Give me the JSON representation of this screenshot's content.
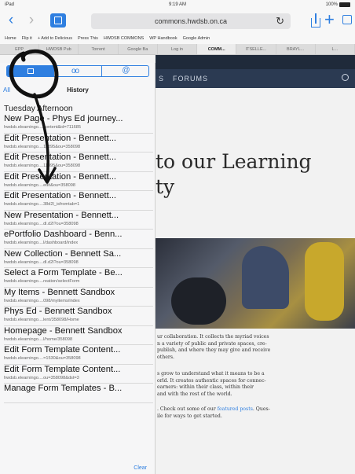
{
  "statusbar": {
    "carrier": "iPad",
    "time": "9:19 AM",
    "battery": "100%"
  },
  "browser": {
    "url": "commons.hwdsb.on.ca",
    "favorites": [
      "Home",
      "Flip it",
      "+ Add to Delicious",
      "Press This",
      "HWDSB COMMONS",
      "WP Handbook",
      "Google Admin"
    ],
    "tabs": [
      {
        "label": "EPP",
        "active": false
      },
      {
        "label": "HWDSB Pub",
        "active": false
      },
      {
        "label": "Torrent",
        "active": false
      },
      {
        "label": "Google Ba",
        "active": false
      },
      {
        "label": "Log in",
        "active": false
      },
      {
        "label": "COMM...",
        "active": true
      },
      {
        "label": "ITSELLE...",
        "active": false
      },
      {
        "label": "BRAYL...",
        "active": false
      },
      {
        "label": "L...",
        "active": false
      }
    ]
  },
  "bookmarks": {
    "back_label": "All",
    "title": "History",
    "section": "Tuesday Afternoon",
    "clear_label": "Clear",
    "items": [
      {
        "title": "New Page - Phys Ed journey...",
        "url": "hwdsb.elearningo....content&id=711685"
      },
      {
        "title": "Edit Presentation - Bennett...",
        "url": "hwdsb.elearningo....11895&ou=358098"
      },
      {
        "title": "Edit Presentation - Bennett...",
        "url": "hwdsb.elearningo....11895&ou=358098"
      },
      {
        "title": "Edit Presentation - Bennett...",
        "url": "hwdsb.elearningo....edit&ou=358098"
      },
      {
        "title": "Edit Presentation - Bennett...",
        "url": "hwdsb.elearningo....38d2l_isfromtab=1"
      },
      {
        "title": "New Presentation - Bennett...",
        "url": "hwdsb.elearningo....dl.d2l?ou=358098"
      },
      {
        "title": "ePortfolio Dashboard - Benn...",
        "url": "hwdsb.elearningo....l/dashboard/index"
      },
      {
        "title": "New Collection - Bennett Sa...",
        "url": "hwdsb.elearningo....dl.d2l?ou=358098"
      },
      {
        "title": "Select a Form Template - Be...",
        "url": "hwdsb.elearningo....reation/selectForm"
      },
      {
        "title": "My Items - Bennett Sandbox",
        "url": "hwdsb.elearningo....098/myitems/index"
      },
      {
        "title": "Phys Ed - Bennett Sandbox",
        "url": "hwdsb.elearningo....lent/358098/Home"
      },
      {
        "title": "Homepage - Bennett Sandbox",
        "url": "hwdsb.elearningo....l/home/358098"
      },
      {
        "title": "Edit Form Template Content...",
        "url": "hwdsb.elearningo....=1530&ou=358098"
      },
      {
        "title": "Edit Form Template Content...",
        "url": "hwdsb.elearningo....ou=358098&dst=3"
      },
      {
        "title": "Manage Form Templates - B...",
        "url": ""
      }
    ]
  },
  "page": {
    "nav_item": "S",
    "nav_item2": "FORUMS",
    "welcome_line1": "to our Learning",
    "welcome_line2": "ty",
    "para1": [
      "ur collaboration. It collects the myriad voices",
      "n a variety of public and private spaces, cre-",
      "publish, and where they may give and receive",
      "others."
    ],
    "para2": [
      "s grow to understand what it means to be a",
      "orld. It creates authentic spaces for connec-",
      "earners: within their class, within their",
      "and with the rest of the world."
    ],
    "para3_a": ". Check out some of our ",
    "para3_link": "featured posts",
    "para3_b": ". Ques-",
    "para3_line2": "ile for ways to get started."
  },
  "colors": {
    "accent": "#2f7fe0",
    "site_nav": "#2b3a52",
    "annotation": "#111111"
  }
}
